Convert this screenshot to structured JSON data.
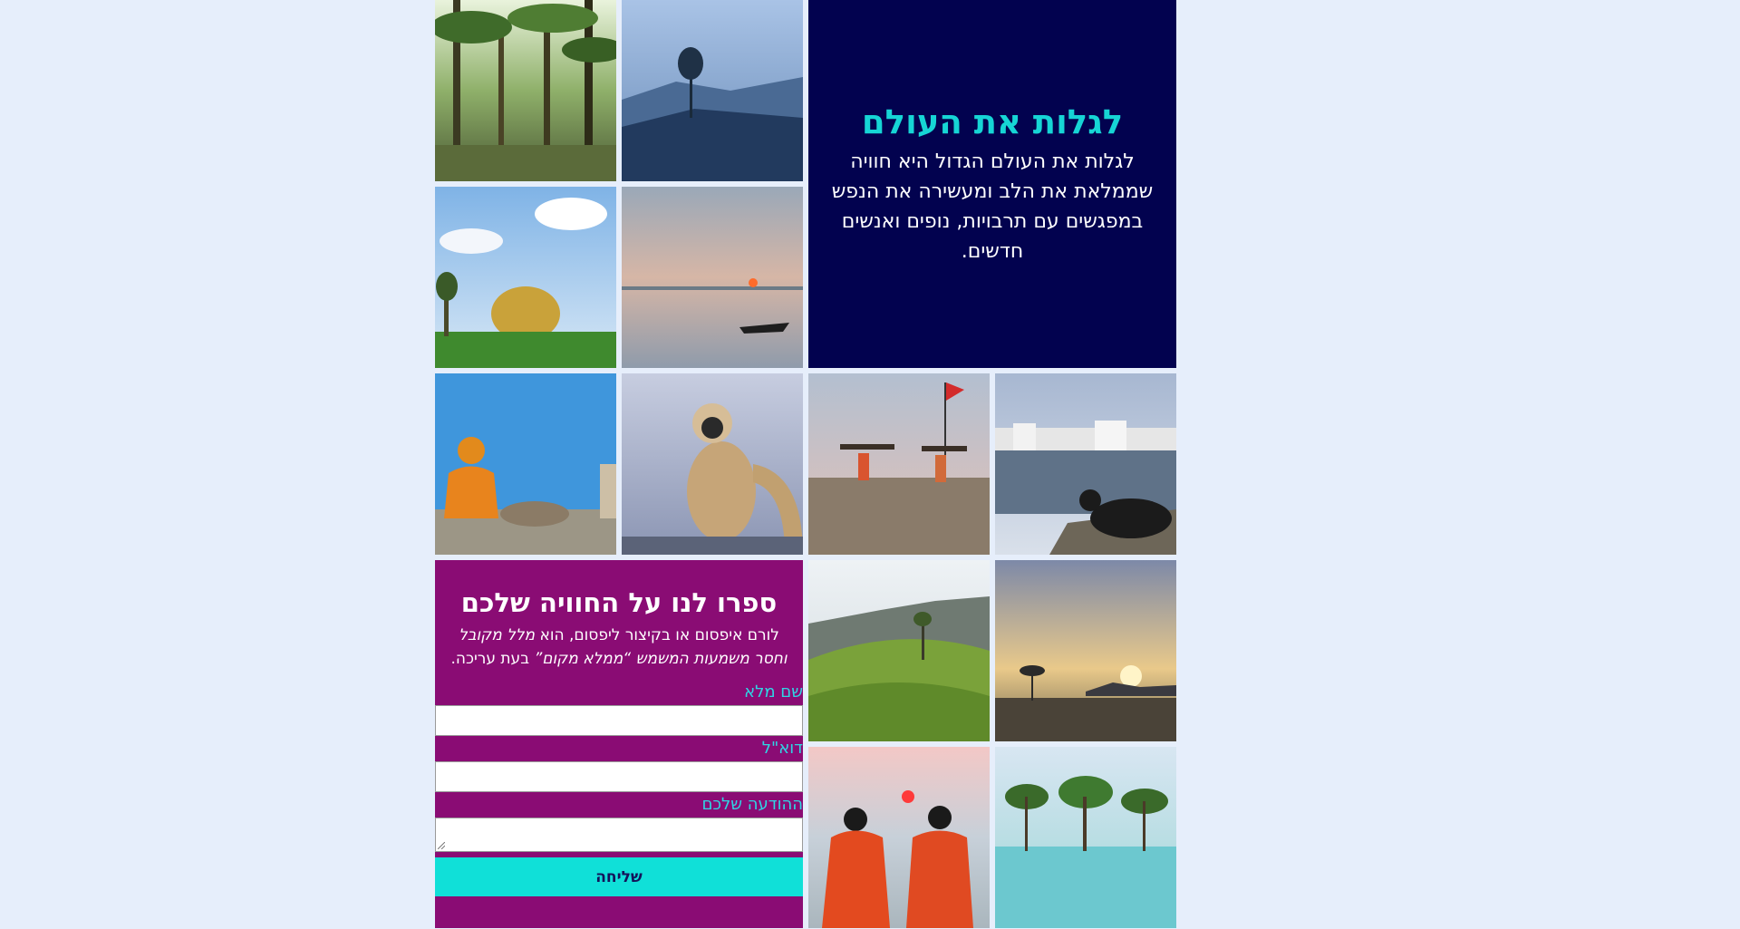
{
  "hero": {
    "title": "לגלות את העולם",
    "text": "לגלות את העולם הגדול היא חוויה שממלאת את הלב ומעשירה את הנפש במפגשים עם תרבויות, נופים ואנשים חדשים."
  },
  "photos": [
    {
      "name": "palm-forest-photo"
    },
    {
      "name": "misty-mountain-photo"
    },
    {
      "name": "golden-dome-photo"
    },
    {
      "name": "sunset-boat-photo"
    },
    {
      "name": "sadhu-blue-wall-photo"
    },
    {
      "name": "langur-monkey-photo"
    },
    {
      "name": "beach-carriers-photo"
    },
    {
      "name": "lake-town-cow-photo"
    },
    {
      "name": "tea-plantation-photo"
    },
    {
      "name": "sunrise-shore-photo"
    },
    {
      "name": "women-sari-sea-photo"
    },
    {
      "name": "mangrove-water-photo"
    }
  ],
  "form": {
    "title": "ספרו לנו על החוויה שלכם",
    "intro_plain": "לורם איפסום או בקיצור ליפסום, הוא ",
    "intro_em": "מלל מקובל וחסר משמעות המשמש “ממלא מקום”",
    "intro_tail": " בעת עריכה.",
    "name_label": "שם מלא",
    "email_label": "דוא\"ל",
    "message_label": "ההודעה שלכם",
    "submit_label": "שליחה"
  },
  "colors": {
    "hero_bg": "#02024f",
    "hero_title": "#16d5d5",
    "form_bg": "#8a0c74",
    "label": "#2fd6e4",
    "submit_bg": "#10e0d8",
    "page_bg": "#e6eefb"
  }
}
